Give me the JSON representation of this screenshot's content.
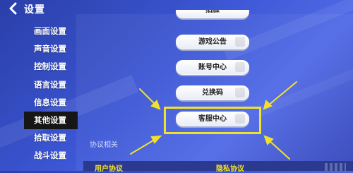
{
  "header": {
    "title": "设置"
  },
  "sidebar": {
    "items": [
      {
        "label": "画面设置"
      },
      {
        "label": "声音设置"
      },
      {
        "label": "控制设置"
      },
      {
        "label": "语言设置"
      },
      {
        "label": "信息设置"
      },
      {
        "label": "其他设置",
        "active": true
      },
      {
        "label": "拾取设置"
      },
      {
        "label": "战斗设置"
      }
    ]
  },
  "main": {
    "buttons": [
      {
        "label": "游戏公告"
      },
      {
        "label": "账号中心"
      },
      {
        "label": "兑换码"
      },
      {
        "label": "客服中心"
      }
    ],
    "top_partial_button": "拍脸",
    "section_title": "协议相关",
    "links": {
      "user_agreement": "用户协议",
      "privacy_policy": "隐私协议"
    }
  },
  "colors": {
    "highlight": "#f2e12a",
    "background": "#3d57d6",
    "active_tab": "#161616"
  }
}
